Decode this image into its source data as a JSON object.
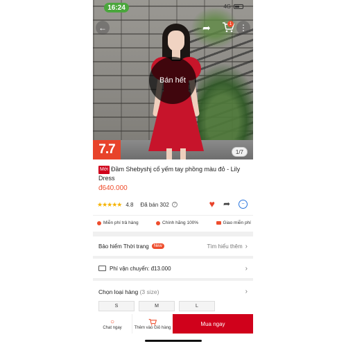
{
  "status_bar": {
    "time": "16:24",
    "network": "4G"
  },
  "header": {
    "cart_badge": "1"
  },
  "hero": {
    "soldout_label": "Bán hết",
    "campaign_logo": "7.7",
    "image_counter": "1/7"
  },
  "product": {
    "tag": "Mới",
    "title": "Đầm Shebyshj cổ yếm tay phồng màu đỏ - Lily Dress",
    "price": "đ640.000",
    "stars": "★★★★★",
    "rating": "4.8",
    "sold": "Đã bán 302"
  },
  "perks": [
    {
      "label": "Miễn phí trả hàng"
    },
    {
      "label": "Chính hãng 100%"
    },
    {
      "label": "Giao miễn phí"
    }
  ],
  "insurance": {
    "label": "Bảo hiểm Thời trang",
    "badge": "New",
    "link": "Tìm hiểu thêm"
  },
  "shipping": {
    "label": "Phí vận chuyển: đ13.000"
  },
  "variant": {
    "label": "Chọn loại hàng",
    "count": "(3 size)",
    "sizes": [
      "S",
      "M",
      "L"
    ]
  },
  "bottom_bar": {
    "chat_label": "Chat ngay",
    "add_cart_label": "Thêm vào Giỏ hàng",
    "buy_label": "Mua ngay"
  },
  "colors": {
    "accent": "#ee4d2d",
    "buy": "#d0011b",
    "status_pill": "#4aa63c"
  }
}
